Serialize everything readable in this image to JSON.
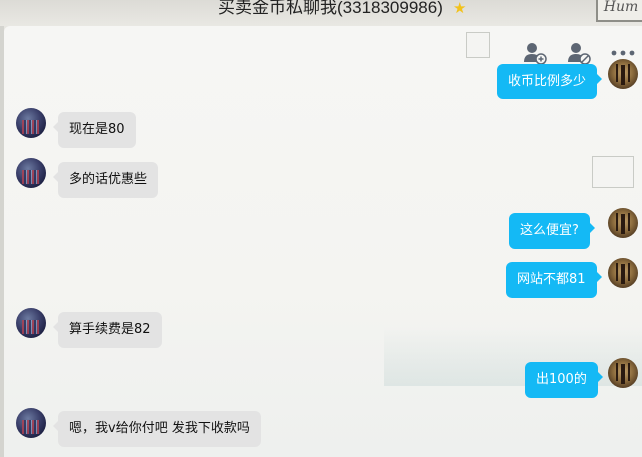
{
  "window": {
    "title": "买卖金币私聊我(3318309986)",
    "star_icon": "star-icon",
    "corner_text": "Hum"
  },
  "toolbar": {
    "icons": [
      "add-friend-icon",
      "block-user-icon",
      "more-icon"
    ]
  },
  "messages": [
    {
      "side": "right",
      "text": "收币比例多少"
    },
    {
      "side": "left",
      "text": "现在是80"
    },
    {
      "side": "left",
      "text": "多的话优惠些"
    },
    {
      "side": "right",
      "text": "这么便宜?"
    },
    {
      "side": "right",
      "text": "网站不都81"
    },
    {
      "side": "left",
      "text": "算手续费是82"
    },
    {
      "side": "right",
      "text": "出100的"
    },
    {
      "side": "left",
      "text": "嗯，我v给你付吧 发我下收款吗"
    }
  ],
  "colors": {
    "outgoing_bubble": "#14b9f5",
    "incoming_bubble": "#e3e3e3",
    "chat_background": "#f6f6f4"
  }
}
